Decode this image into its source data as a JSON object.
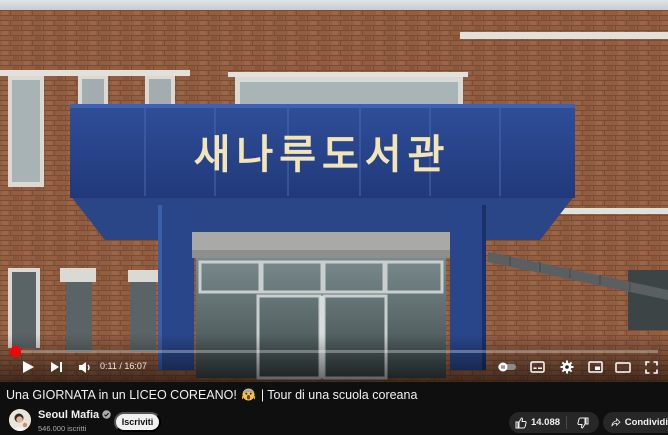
{
  "colors": {
    "accent": "#ff0000",
    "bg": "#0f0f0f",
    "chip": "#272727"
  },
  "player": {
    "sign_text": "새나루도서관",
    "progress": 0.007,
    "time_current": "0:11",
    "time_separator": " / ",
    "time_total": "16:07"
  },
  "controls": {
    "left": [
      "play-icon",
      "next-icon",
      "volume-icon"
    ],
    "right": [
      "autoplay-toggle-icon",
      "subtitles-icon",
      "settings-icon",
      "miniplayer-icon",
      "theater-mode-icon",
      "fullscreen-icon"
    ]
  },
  "video": {
    "title_part1": "Una GIORNATA in un LICEO COREANO!",
    "title_part2": " | Tour di una scuola coreana"
  },
  "channel": {
    "name": "Seoul Mafia",
    "subscribers": "546.000 iscritti",
    "subscribe_label": "Iscriviti"
  },
  "actions": {
    "like_count": "14.088",
    "share_label": "Condividi"
  }
}
